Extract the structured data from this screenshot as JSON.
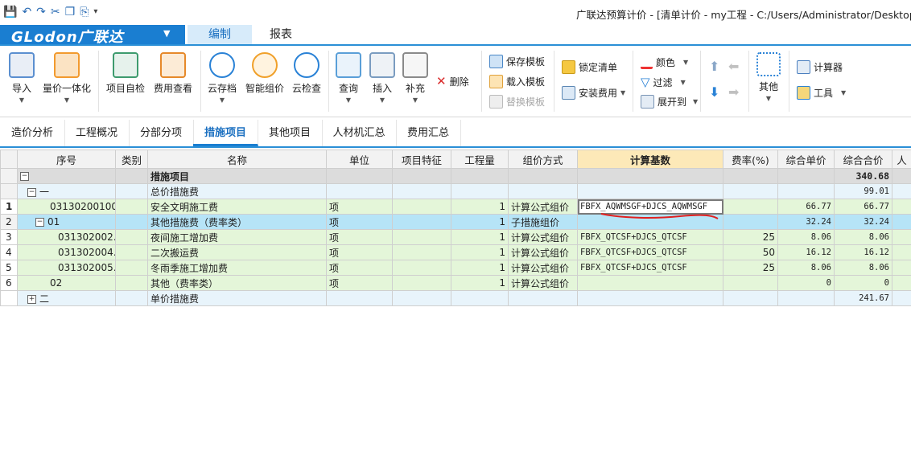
{
  "window": {
    "title": "广联达预算计价 - [清单计价 - my工程 - C:/Users/Administrator/Desktop/m"
  },
  "quick_access": [
    "save-icon",
    "undo-icon",
    "redo-icon",
    "cut-icon",
    "copy-icon",
    "paste-icon",
    "more-icon"
  ],
  "app": {
    "brand": "GLodon广联达"
  },
  "menu": {
    "tabs": [
      "编制",
      "报表"
    ],
    "active": "编制"
  },
  "ribbon": {
    "buttons": [
      {
        "label": "导入",
        "icon": "import-icon"
      },
      {
        "label": "量价一体化",
        "icon": "quantity-price-icon"
      },
      {
        "label": "项目自检",
        "icon": "self-check-icon"
      },
      {
        "label": "费用查看",
        "icon": "cost-view-icon"
      },
      {
        "label": "云存档",
        "icon": "cloud-save-icon"
      },
      {
        "label": "智能组价",
        "icon": "smart-price-icon"
      },
      {
        "label": "云检查",
        "icon": "cloud-check-icon"
      },
      {
        "label": "查询",
        "icon": "query-icon"
      },
      {
        "label": "插入",
        "icon": "insert-icon"
      },
      {
        "label": "补充",
        "icon": "supplement-icon"
      },
      {
        "label": "删除",
        "icon": "delete-icon"
      },
      {
        "label": "其他",
        "icon": "other-icon"
      }
    ],
    "template": {
      "save": "保存模板",
      "load": "载入模板",
      "replace": "替换模板"
    },
    "lock": "锁定清单",
    "install_cost": "安装费用",
    "color": "颜色",
    "filter": "过滤",
    "expand": "展开到",
    "calculator": "计算器",
    "tools": "工具"
  },
  "subtabs": {
    "items": [
      "造价分析",
      "工程概况",
      "分部分项",
      "措施项目",
      "其他项目",
      "人材机汇总",
      "费用汇总"
    ],
    "active": "措施项目"
  },
  "table": {
    "columns": [
      "序号",
      "类别",
      "名称",
      "单位",
      "项目特征",
      "工程量",
      "组价方式",
      "计算基数",
      "费率(%)",
      "综合单价",
      "综合合价",
      "人"
    ],
    "rows": [
      {
        "rn": "",
        "seq": "",
        "cat": "",
        "name": "措施项目",
        "unit": "",
        "feat": "",
        "qty": "",
        "method": "",
        "base": "",
        "rate": "",
        "unit_price": "",
        "total": "340.68"
      },
      {
        "rn": "",
        "seq": "一",
        "cat": "",
        "name": "总价措施费",
        "unit": "",
        "feat": "",
        "qty": "",
        "method": "",
        "base": "",
        "rate": "",
        "unit_price": "",
        "total": "99.01"
      },
      {
        "rn": "1",
        "seq": "031302001001",
        "cat": "",
        "name": "安全文明施工费",
        "unit": "项",
        "feat": "",
        "qty": "1",
        "method": "计算公式组价",
        "base": "FBFX_AQWMSGF+DJCS_AQWMSGF",
        "rate": "",
        "unit_price": "66.77",
        "total": "66.77"
      },
      {
        "rn": "2",
        "seq": "01",
        "cat": "",
        "name": "其他措施费（费率类）",
        "unit": "项",
        "feat": "",
        "qty": "1",
        "method": "子措施组价",
        "base": "",
        "rate": "",
        "unit_price": "32.24",
        "total": "32.24"
      },
      {
        "rn": "3",
        "seq": "031302002…",
        "cat": "",
        "name": "夜间施工增加费",
        "unit": "项",
        "feat": "",
        "qty": "1",
        "method": "计算公式组价",
        "base": "FBFX_QTCSF+DJCS_QTCSF",
        "rate": "25",
        "unit_price": "8.06",
        "total": "8.06"
      },
      {
        "rn": "4",
        "seq": "031302004…",
        "cat": "",
        "name": "二次搬运费",
        "unit": "项",
        "feat": "",
        "qty": "1",
        "method": "计算公式组价",
        "base": "FBFX_QTCSF+DJCS_QTCSF",
        "rate": "50",
        "unit_price": "16.12",
        "total": "16.12"
      },
      {
        "rn": "5",
        "seq": "031302005…",
        "cat": "",
        "name": "冬雨季施工增加费",
        "unit": "项",
        "feat": "",
        "qty": "1",
        "method": "计算公式组价",
        "base": "FBFX_QTCSF+DJCS_QTCSF",
        "rate": "25",
        "unit_price": "8.06",
        "total": "8.06"
      },
      {
        "rn": "6",
        "seq": "02",
        "cat": "",
        "name": "其他（费率类）",
        "unit": "项",
        "feat": "",
        "qty": "1",
        "method": "计算公式组价",
        "base": "",
        "rate": "",
        "unit_price": "0",
        "total": "0"
      },
      {
        "rn": "",
        "seq": "二",
        "cat": "",
        "name": "单价措施费",
        "unit": "",
        "feat": "",
        "qty": "",
        "method": "",
        "base": "",
        "rate": "",
        "unit_price": "",
        "total": "241.67"
      }
    ]
  },
  "colors": {
    "accent": "#1a7ed1",
    "row_green": "#e4f6d9",
    "row_selected": "#b6e4f7",
    "calc_header": "#fde9b8",
    "annotation_red": "#e02020"
  }
}
